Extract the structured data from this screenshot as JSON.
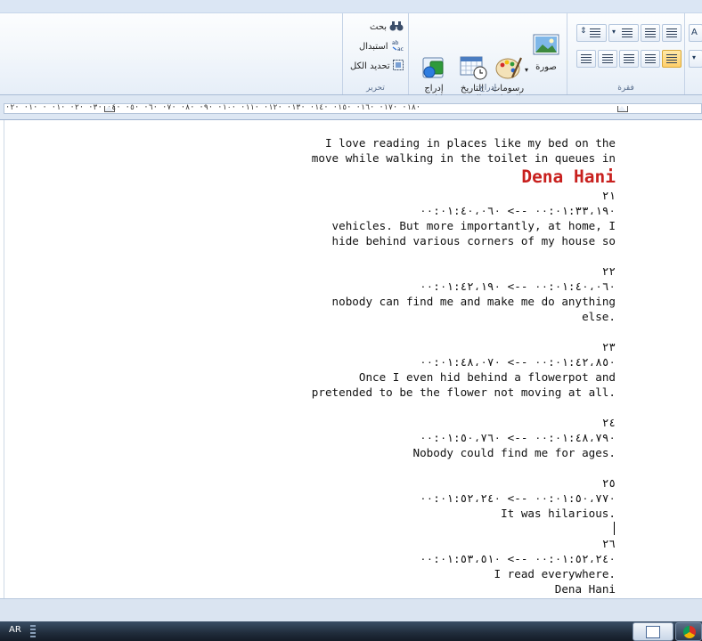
{
  "ribbon": {
    "editing": {
      "label": "تحرير",
      "find": "بحث",
      "replace": "استبدال",
      "select_all": "تحديد الكل"
    },
    "insert": {
      "label": "إدراج",
      "insert_object": "إدراج\nكائن",
      "date_time": "التاريخ\nوالوقت",
      "paint_drawing": "رسومات\nالرسام",
      "picture": "صورة"
    },
    "paragraph": {
      "label": "فقرة"
    }
  },
  "ruler": {
    "scale": "·١٨· ·١٧· ·١٦· ·١٥· ·١٤· ·١٣· ·١٢· ·١١· ·١٠· ·٩· ·٨· ·٧· ·٦· ·٥· ·٤· ·٣· ·٢· ·١· · ·١· ·٢·"
  },
  "document": {
    "lines": [
      {
        "text": "I love reading in places like my bed on the",
        "style": "normal"
      },
      {
        "text": "move while walking in the toilet in queues in",
        "style": "normal"
      },
      {
        "text": "Dena Hani",
        "style": "red"
      },
      {
        "text": "٢١",
        "style": "normal"
      },
      {
        "text": "٠٠:٠١:٣٣،١٩٠ --> ٠٠:٠١:٤٠،٠٦٠",
        "style": "normal"
      },
      {
        "text": "vehicles. But more importantly, at home, I",
        "style": "normal"
      },
      {
        "text": "hide behind various corners of my house so",
        "style": "normal"
      },
      {
        "text": "",
        "style": "normal"
      },
      {
        "text": "٢٢",
        "style": "normal"
      },
      {
        "text": "٠٠:٠١:٤٠،٠٦٠ --> ٠٠:٠١:٤٢،١٩٠",
        "style": "normal"
      },
      {
        "text": "nobody can find me and make me do anything",
        "style": "normal"
      },
      {
        "text": ".else",
        "style": "normal"
      },
      {
        "text": "",
        "style": "normal"
      },
      {
        "text": "٢٣",
        "style": "normal"
      },
      {
        "text": "٠٠:٠١:٤٢،٨٥٠ --> ٠٠:٠١:٤٨،٠٧٠",
        "style": "normal"
      },
      {
        "text": "Once I even hid behind a flowerpot and",
        "style": "normal"
      },
      {
        "text": ".pretended to be the flower not moving at all",
        "style": "normal"
      },
      {
        "text": "",
        "style": "normal"
      },
      {
        "text": "٢٤",
        "style": "normal"
      },
      {
        "text": "٠٠:٠١:٤٨،٧٩٠ --> ٠٠:٠١:٥٠،٧٦٠",
        "style": "normal"
      },
      {
        "text": ".Nobody could find me for ages",
        "style": "normal"
      },
      {
        "text": "",
        "style": "normal"
      },
      {
        "text": "٢٥",
        "style": "normal"
      },
      {
        "text": "٠٠:٠١:٥٠،٧٧٠ --> ٠٠:٠١:٥٢،٢٤٠",
        "style": "normal"
      },
      {
        "text": ".It was hilarious",
        "style": "normal"
      },
      {
        "text": "",
        "style": "normal"
      },
      {
        "text": "٢٦",
        "style": "normal"
      },
      {
        "text": "٠٠:٠١:٥٢،٢٤٠ --> ٠٠:٠١:٥٣،٥١٠",
        "style": "normal"
      },
      {
        "text": ".I read everywhere",
        "style": "normal"
      },
      {
        "text": "Dena Hani",
        "style": "normal"
      }
    ]
  },
  "taskbar": {
    "language": "AR"
  },
  "colors": {
    "accent_red": "#c8201e",
    "ribbon_text": "#1e395b",
    "active_button": "#ffcf6a"
  }
}
